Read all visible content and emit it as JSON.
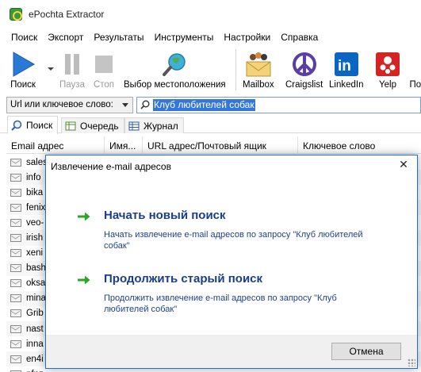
{
  "window": {
    "title": "ePochta Extractor"
  },
  "menu": [
    "Поиск",
    "Экспорт",
    "Результаты",
    "Инструменты",
    "Настройки",
    "Справка"
  ],
  "toolbar": {
    "search": "Поиск",
    "pause": "Пауза",
    "stop": "Стоп",
    "location": "Выбор местоположения",
    "mailbox": "Mailbox",
    "craigslist": "Craigslist",
    "linkedin": "LinkedIn",
    "yelp": "Yelp",
    "more": "Пои"
  },
  "search": {
    "mode": "Url или ключевое слово:",
    "query": "Клуб любителей собак"
  },
  "tabs": [
    "Поиск",
    "Очередь",
    "Журнал"
  ],
  "grid": {
    "columns": [
      "Email адрес",
      "Имя...",
      "URL адрес/Почтовый ящик",
      "Ключевое слово"
    ],
    "rows": [
      "sales",
      "info",
      "bika",
      "fenix",
      "veo-",
      "irish",
      "xeni",
      "bash",
      "oksa",
      "mina",
      "Grib",
      "nast",
      "inna",
      "en4i",
      "nfnz"
    ]
  },
  "dialog": {
    "title": "Извлечение e-mail адресов",
    "close": "✕",
    "option1": {
      "title": "Начать новый поиск",
      "desc": "Начать извлечение e-mail адресов по запросу \"Клуб любителей собак\""
    },
    "option2": {
      "title": "Продолжить старый поиск",
      "desc": "Продолжить извлечение e-mail адресов по запросу \"Клуб любителей собак\""
    },
    "cancel": "Отмена"
  },
  "colors": {
    "accent": "#1e6fd1",
    "link": "#1a3e8a",
    "arrow": "#2aa52a",
    "selection": "#3377dd"
  }
}
